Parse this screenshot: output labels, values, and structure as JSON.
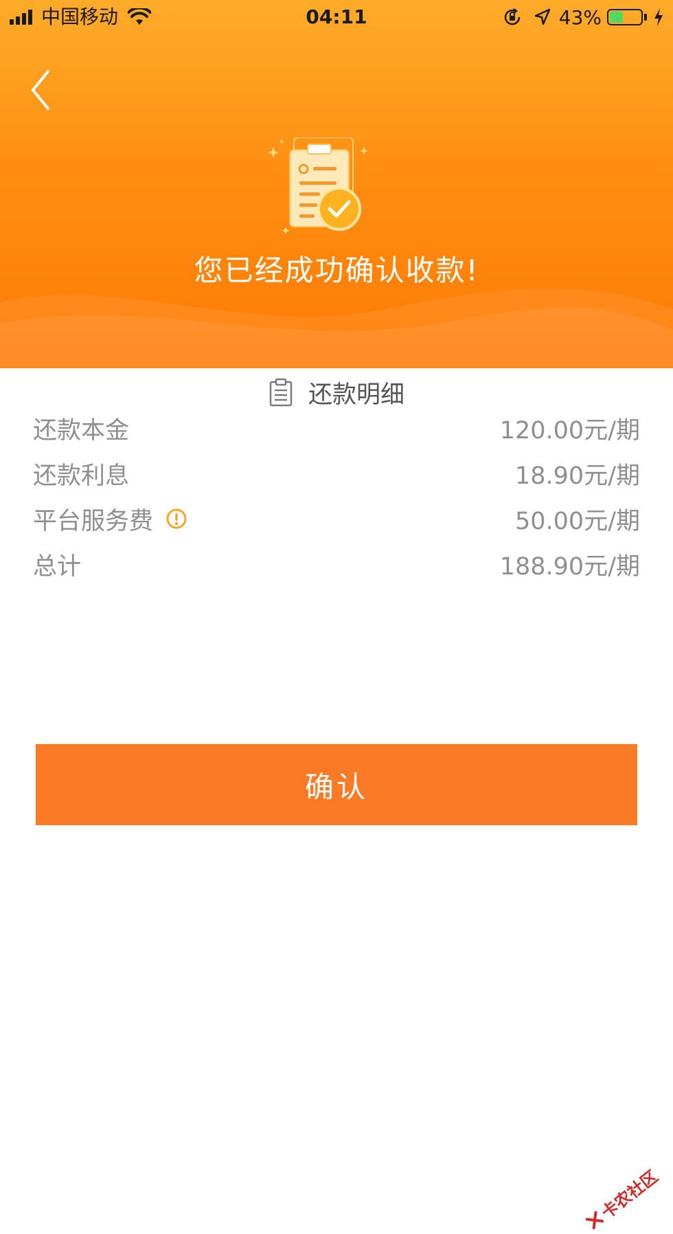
{
  "status_bar": {
    "carrier": "中国移动",
    "time": "04:11",
    "battery_percent": "43%",
    "battery_level": 0.43,
    "icons": [
      "signal-icon",
      "wifi-icon",
      "orientation-lock-icon",
      "location-arrow-icon",
      "battery-icon",
      "charging-bolt-icon"
    ]
  },
  "header": {
    "back_icon": "chevron-left-icon",
    "illustration": "clipboard-check-icon",
    "success_message": "您已经成功确认收款!"
  },
  "details": {
    "title": "还款明细",
    "title_icon": "clipboard-list-icon",
    "rows": [
      {
        "label": "还款本金",
        "value": "120.00元/期"
      },
      {
        "label": "还款利息",
        "value": "18.90元/期"
      },
      {
        "label": "平台服务费",
        "value": "50.00元/期",
        "info_icon": "exclamation-circle-icon"
      },
      {
        "label": "总计",
        "value": "188.90元/期"
      }
    ]
  },
  "confirm_button": {
    "label": "确认"
  },
  "watermark": {
    "text": "卡农社区"
  },
  "colors": {
    "header_top": "#ffab2a",
    "header_bottom": "#ff7a05",
    "button": "#fb7a25",
    "battery_fill": "#4cd964",
    "info_icon": "#f5a623",
    "text_gray": "#8f8f8f"
  }
}
